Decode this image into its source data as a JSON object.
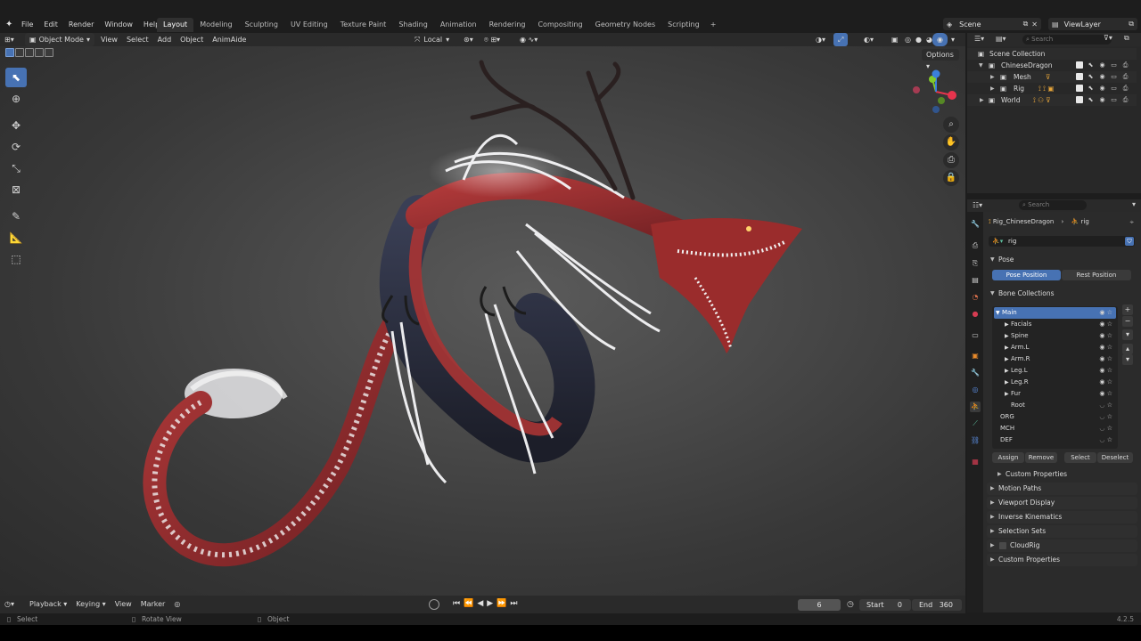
{
  "app": {
    "menu": [
      "File",
      "Edit",
      "Render",
      "Window",
      "Help"
    ],
    "workspaces": [
      "Layout",
      "Modeling",
      "Sculpting",
      "UV Editing",
      "Texture Paint",
      "Shading",
      "Animation",
      "Rendering",
      "Compositing",
      "Geometry Nodes",
      "Scripting"
    ],
    "active_workspace": "Layout",
    "scene": "Scene",
    "view_layer": "ViewLayer",
    "version": "4.2.5"
  },
  "viewport_header": {
    "mode": "Object Mode",
    "menus": [
      "View",
      "Select",
      "Add",
      "Object",
      "AnimAide"
    ],
    "transform_orientation": "Local",
    "options_label": "Options"
  },
  "outliner": {
    "search_placeholder": "Search",
    "rows": [
      {
        "label": "Scene Collection",
        "icons": false
      },
      {
        "label": "ChineseDragon",
        "icons": true
      },
      {
        "label": "Mesh",
        "icons": true
      },
      {
        "label": "Rig",
        "icons": true
      },
      {
        "label": "World",
        "icons": true
      }
    ]
  },
  "properties": {
    "search_placeholder": "Search",
    "breadcrumb_object": "Rig_ChineseDragon",
    "breadcrumb_data": "rig",
    "data_name": "rig",
    "pose_label": "Pose",
    "pose_position": "Pose Position",
    "rest_position": "Rest Position",
    "bone_collections_label": "Bone Collections",
    "bone_collections": [
      {
        "name": "Main",
        "selected": true,
        "visible": true
      },
      {
        "name": "Facials",
        "selected": false,
        "visible": true
      },
      {
        "name": "Spine",
        "selected": false,
        "visible": true
      },
      {
        "name": "Arm.L",
        "selected": false,
        "visible": true
      },
      {
        "name": "Arm.R",
        "selected": false,
        "visible": true
      },
      {
        "name": "Leg.L",
        "selected": false,
        "visible": true
      },
      {
        "name": "Leg.R",
        "selected": false,
        "visible": true
      },
      {
        "name": "Fur",
        "selected": false,
        "visible": true
      },
      {
        "name": "Root",
        "selected": false,
        "visible": false
      },
      {
        "name": "ORG",
        "selected": false,
        "visible": false
      },
      {
        "name": "MCH",
        "selected": false,
        "visible": false
      },
      {
        "name": "DEF",
        "selected": false,
        "visible": false
      }
    ],
    "assign": "Assign",
    "remove": "Remove",
    "select": "Select",
    "deselect": "Deselect",
    "custom_properties_sub": "Custom Properties",
    "panels": [
      "Motion Paths",
      "Viewport Display",
      "Inverse Kinematics",
      "Selection Sets",
      "CloudRig",
      "Custom Properties"
    ]
  },
  "timeline": {
    "menus": [
      "Playback",
      "Keying",
      "View",
      "Marker"
    ],
    "current_frame": "6",
    "start_label": "Start",
    "start_value": "0",
    "end_label": "End",
    "end_value": "360"
  },
  "statusbar": {
    "left": "Select",
    "middle": "Rotate View",
    "right": "Object"
  },
  "colors": {
    "accent": "#4772b3",
    "gizmo_x": "#e6344d",
    "gizmo_y": "#83c92a",
    "gizmo_z": "#3b7fdc"
  }
}
